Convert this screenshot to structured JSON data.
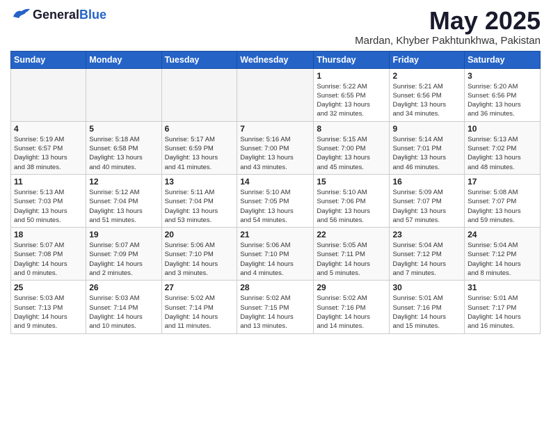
{
  "header": {
    "logo_general": "General",
    "logo_blue": "Blue",
    "title": "May 2025",
    "subtitle": "Mardan, Khyber Pakhtunkhwa, Pakistan"
  },
  "calendar": {
    "days_of_week": [
      "Sunday",
      "Monday",
      "Tuesday",
      "Wednesday",
      "Thursday",
      "Friday",
      "Saturday"
    ],
    "weeks": [
      [
        {
          "day": "",
          "info": ""
        },
        {
          "day": "",
          "info": ""
        },
        {
          "day": "",
          "info": ""
        },
        {
          "day": "",
          "info": ""
        },
        {
          "day": "1",
          "info": "Sunrise: 5:22 AM\nSunset: 6:55 PM\nDaylight: 13 hours\nand 32 minutes."
        },
        {
          "day": "2",
          "info": "Sunrise: 5:21 AM\nSunset: 6:56 PM\nDaylight: 13 hours\nand 34 minutes."
        },
        {
          "day": "3",
          "info": "Sunrise: 5:20 AM\nSunset: 6:56 PM\nDaylight: 13 hours\nand 36 minutes."
        }
      ],
      [
        {
          "day": "4",
          "info": "Sunrise: 5:19 AM\nSunset: 6:57 PM\nDaylight: 13 hours\nand 38 minutes."
        },
        {
          "day": "5",
          "info": "Sunrise: 5:18 AM\nSunset: 6:58 PM\nDaylight: 13 hours\nand 40 minutes."
        },
        {
          "day": "6",
          "info": "Sunrise: 5:17 AM\nSunset: 6:59 PM\nDaylight: 13 hours\nand 41 minutes."
        },
        {
          "day": "7",
          "info": "Sunrise: 5:16 AM\nSunset: 7:00 PM\nDaylight: 13 hours\nand 43 minutes."
        },
        {
          "day": "8",
          "info": "Sunrise: 5:15 AM\nSunset: 7:00 PM\nDaylight: 13 hours\nand 45 minutes."
        },
        {
          "day": "9",
          "info": "Sunrise: 5:14 AM\nSunset: 7:01 PM\nDaylight: 13 hours\nand 46 minutes."
        },
        {
          "day": "10",
          "info": "Sunrise: 5:13 AM\nSunset: 7:02 PM\nDaylight: 13 hours\nand 48 minutes."
        }
      ],
      [
        {
          "day": "11",
          "info": "Sunrise: 5:13 AM\nSunset: 7:03 PM\nDaylight: 13 hours\nand 50 minutes."
        },
        {
          "day": "12",
          "info": "Sunrise: 5:12 AM\nSunset: 7:04 PM\nDaylight: 13 hours\nand 51 minutes."
        },
        {
          "day": "13",
          "info": "Sunrise: 5:11 AM\nSunset: 7:04 PM\nDaylight: 13 hours\nand 53 minutes."
        },
        {
          "day": "14",
          "info": "Sunrise: 5:10 AM\nSunset: 7:05 PM\nDaylight: 13 hours\nand 54 minutes."
        },
        {
          "day": "15",
          "info": "Sunrise: 5:10 AM\nSunset: 7:06 PM\nDaylight: 13 hours\nand 56 minutes."
        },
        {
          "day": "16",
          "info": "Sunrise: 5:09 AM\nSunset: 7:07 PM\nDaylight: 13 hours\nand 57 minutes."
        },
        {
          "day": "17",
          "info": "Sunrise: 5:08 AM\nSunset: 7:07 PM\nDaylight: 13 hours\nand 59 minutes."
        }
      ],
      [
        {
          "day": "18",
          "info": "Sunrise: 5:07 AM\nSunset: 7:08 PM\nDaylight: 14 hours\nand 0 minutes."
        },
        {
          "day": "19",
          "info": "Sunrise: 5:07 AM\nSunset: 7:09 PM\nDaylight: 14 hours\nand 2 minutes."
        },
        {
          "day": "20",
          "info": "Sunrise: 5:06 AM\nSunset: 7:10 PM\nDaylight: 14 hours\nand 3 minutes."
        },
        {
          "day": "21",
          "info": "Sunrise: 5:06 AM\nSunset: 7:10 PM\nDaylight: 14 hours\nand 4 minutes."
        },
        {
          "day": "22",
          "info": "Sunrise: 5:05 AM\nSunset: 7:11 PM\nDaylight: 14 hours\nand 5 minutes."
        },
        {
          "day": "23",
          "info": "Sunrise: 5:04 AM\nSunset: 7:12 PM\nDaylight: 14 hours\nand 7 minutes."
        },
        {
          "day": "24",
          "info": "Sunrise: 5:04 AM\nSunset: 7:12 PM\nDaylight: 14 hours\nand 8 minutes."
        }
      ],
      [
        {
          "day": "25",
          "info": "Sunrise: 5:03 AM\nSunset: 7:13 PM\nDaylight: 14 hours\nand 9 minutes."
        },
        {
          "day": "26",
          "info": "Sunrise: 5:03 AM\nSunset: 7:14 PM\nDaylight: 14 hours\nand 10 minutes."
        },
        {
          "day": "27",
          "info": "Sunrise: 5:02 AM\nSunset: 7:14 PM\nDaylight: 14 hours\nand 11 minutes."
        },
        {
          "day": "28",
          "info": "Sunrise: 5:02 AM\nSunset: 7:15 PM\nDaylight: 14 hours\nand 13 minutes."
        },
        {
          "day": "29",
          "info": "Sunrise: 5:02 AM\nSunset: 7:16 PM\nDaylight: 14 hours\nand 14 minutes."
        },
        {
          "day": "30",
          "info": "Sunrise: 5:01 AM\nSunset: 7:16 PM\nDaylight: 14 hours\nand 15 minutes."
        },
        {
          "day": "31",
          "info": "Sunrise: 5:01 AM\nSunset: 7:17 PM\nDaylight: 14 hours\nand 16 minutes."
        }
      ]
    ]
  }
}
